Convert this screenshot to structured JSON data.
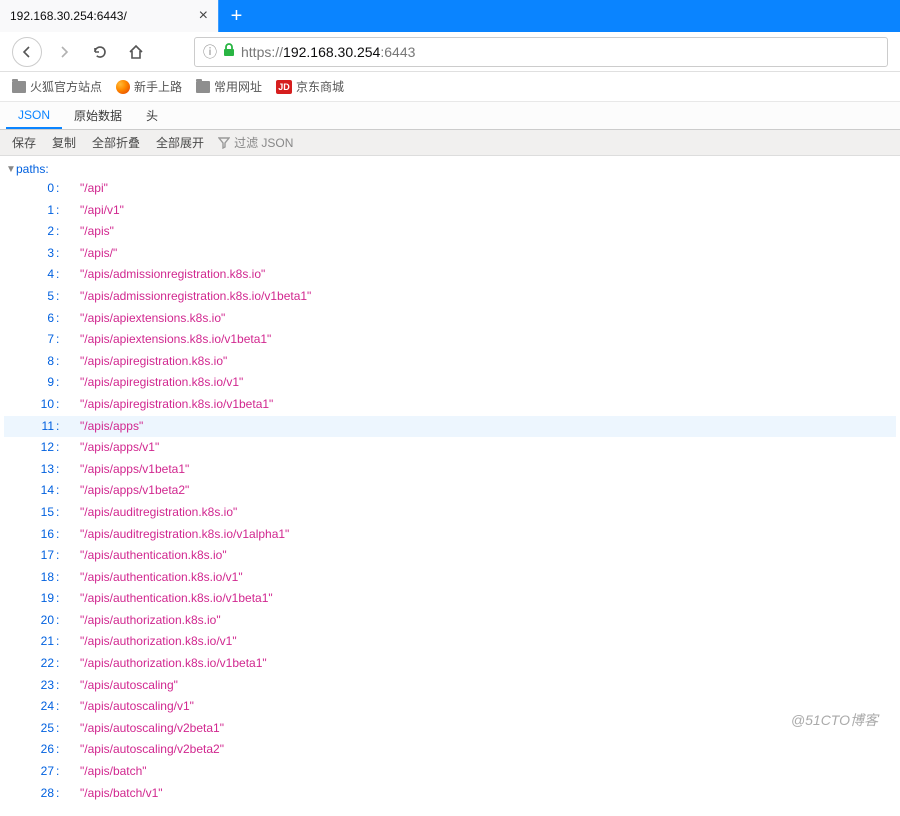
{
  "tab": {
    "title": "192.168.30.254:6443/"
  },
  "url": {
    "protocol": "https://",
    "host": "192.168.30.254",
    "port": ":6443"
  },
  "bookmarks": {
    "b1": "火狐官方站点",
    "b2": "新手上路",
    "b3": "常用网址",
    "b4": "京东商城",
    "jd_badge": "JD"
  },
  "viewer_tabs": {
    "json": "JSON",
    "raw": "原始数据",
    "headers": "头"
  },
  "actions": {
    "save": "保存",
    "copy": "复制",
    "collapse": "全部折叠",
    "expand": "全部展开",
    "filter_placeholder": "过滤 JSON"
  },
  "json": {
    "root_key": "paths:",
    "highlight_index": 11,
    "items": [
      "\"/api\"",
      "\"/api/v1\"",
      "\"/apis\"",
      "\"/apis/\"",
      "\"/apis/admissionregistration.k8s.io\"",
      "\"/apis/admissionregistration.k8s.io/v1beta1\"",
      "\"/apis/apiextensions.k8s.io\"",
      "\"/apis/apiextensions.k8s.io/v1beta1\"",
      "\"/apis/apiregistration.k8s.io\"",
      "\"/apis/apiregistration.k8s.io/v1\"",
      "\"/apis/apiregistration.k8s.io/v1beta1\"",
      "\"/apis/apps\"",
      "\"/apis/apps/v1\"",
      "\"/apis/apps/v1beta1\"",
      "\"/apis/apps/v1beta2\"",
      "\"/apis/auditregistration.k8s.io\"",
      "\"/apis/auditregistration.k8s.io/v1alpha1\"",
      "\"/apis/authentication.k8s.io\"",
      "\"/apis/authentication.k8s.io/v1\"",
      "\"/apis/authentication.k8s.io/v1beta1\"",
      "\"/apis/authorization.k8s.io\"",
      "\"/apis/authorization.k8s.io/v1\"",
      "\"/apis/authorization.k8s.io/v1beta1\"",
      "\"/apis/autoscaling\"",
      "\"/apis/autoscaling/v1\"",
      "\"/apis/autoscaling/v2beta1\"",
      "\"/apis/autoscaling/v2beta2\"",
      "\"/apis/batch\"",
      "\"/apis/batch/v1\""
    ]
  },
  "watermark": "@51CTO博客"
}
